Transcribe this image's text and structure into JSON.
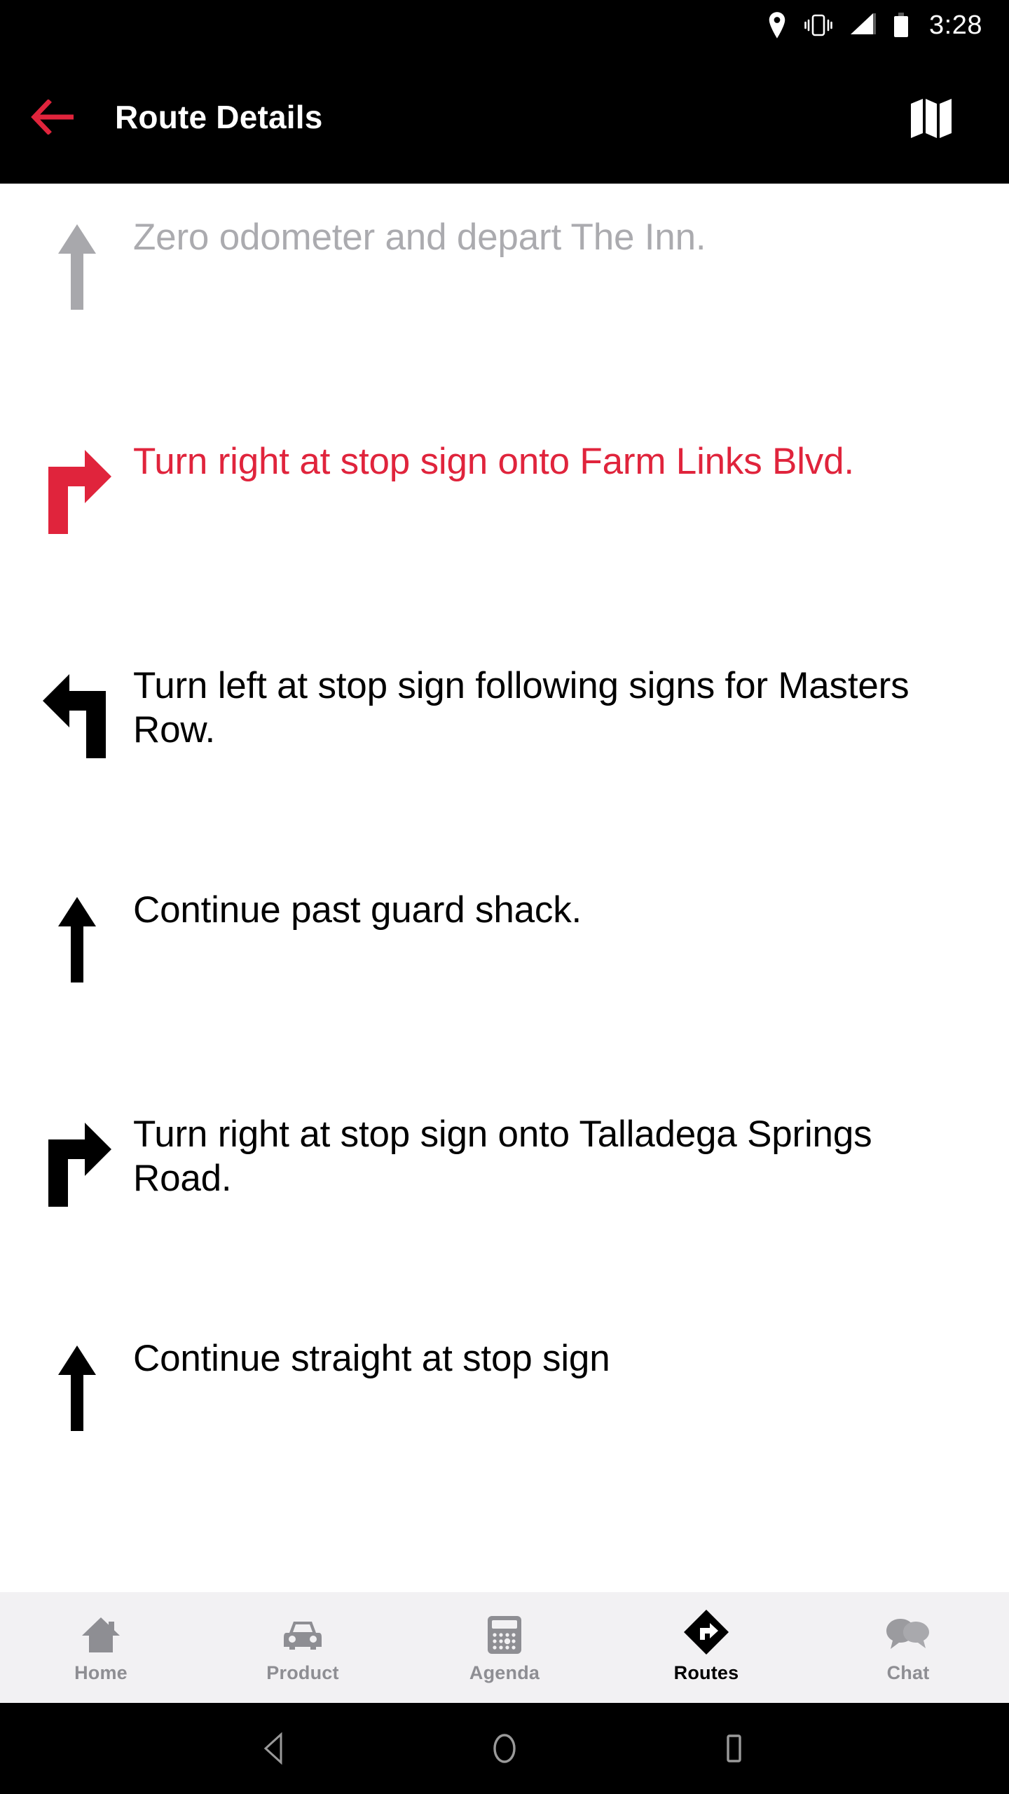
{
  "statusbar": {
    "time": "3:28",
    "icons": [
      "location-pin-icon",
      "vibrate-icon",
      "signal-bars-icon",
      "battery-icon"
    ]
  },
  "appbar": {
    "title": "Route Details",
    "back_icon": "back-arrow-icon",
    "map_icon": "map-icon",
    "accent_color": "#e0243c",
    "background_color": "#000000"
  },
  "route": {
    "steps": [
      {
        "icon": "arrow-straight-icon",
        "text": "Zero odometer and depart The Inn.",
        "state": "completed",
        "color": "#ababaf"
      },
      {
        "icon": "arrow-turn-right-icon",
        "text": "Turn right at stop sign onto Farm Links Blvd.",
        "state": "active",
        "color": "#e0243c"
      },
      {
        "icon": "arrow-turn-left-icon",
        "text": "Turn left at stop sign following signs for Masters Row.",
        "state": "upcoming",
        "color": "#000000"
      },
      {
        "icon": "arrow-straight-icon",
        "text": "Continue past guard shack.",
        "state": "upcoming",
        "color": "#000000"
      },
      {
        "icon": "arrow-turn-right-icon",
        "text": "Turn right at stop sign onto Talladega Springs Road.",
        "state": "upcoming",
        "color": "#000000"
      },
      {
        "icon": "arrow-straight-icon",
        "text": "Continue straight at stop sign",
        "state": "upcoming",
        "color": "#000000"
      }
    ]
  },
  "tabbar": {
    "background_color": "#f2f1f3",
    "inactive_color": "#8e8e93",
    "active_color": "#000000",
    "tabs": [
      {
        "label": "Home",
        "icon": "house-icon",
        "active": false
      },
      {
        "label": "Product",
        "icon": "car-icon",
        "active": false
      },
      {
        "label": "Agenda",
        "icon": "calculator-icon",
        "active": false
      },
      {
        "label": "Routes",
        "icon": "route-diamond-icon",
        "active": true
      },
      {
        "label": "Chat",
        "icon": "chat-bubbles-icon",
        "active": false
      }
    ]
  },
  "sysnav": {
    "buttons": [
      {
        "name": "back-triangle-icon"
      },
      {
        "name": "home-circle-icon"
      },
      {
        "name": "recents-square-icon"
      }
    ]
  }
}
